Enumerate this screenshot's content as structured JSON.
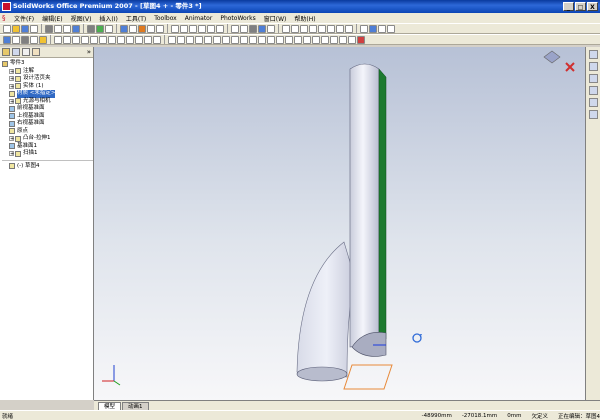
{
  "window": {
    "title": "SolidWorks Office Premium 2007 - [草图4 + - 零件3 *]",
    "buttons": [
      "_",
      "□",
      "X"
    ]
  },
  "menu": {
    "items": [
      "文件(F)",
      "编辑(E)",
      "视图(V)",
      "插入(I)",
      "工具(T)",
      "Toolbox",
      "Animator",
      "PhotoWorks",
      "窗口(W)",
      "帮助(H)"
    ]
  },
  "feature_tree": {
    "items": [
      {
        "label": "零件3",
        "level": 0,
        "icon": "part-icon"
      },
      {
        "label": "注解",
        "level": 1,
        "icon": "annotation-icon",
        "expander": "+"
      },
      {
        "label": "设计活页夹",
        "level": 1,
        "icon": "design-binder-icon",
        "expander": "+"
      },
      {
        "label": "实体 (1)",
        "level": 1,
        "icon": "solid-body-icon",
        "expander": "+"
      },
      {
        "label": "材质 <未指定>",
        "level": 1,
        "icon": "material-icon",
        "selected": true
      },
      {
        "label": "光源与相机",
        "level": 1,
        "icon": "lights-cameras-icon",
        "expander": "+"
      },
      {
        "label": "前视基准面",
        "level": 1,
        "icon": "plane-icon"
      },
      {
        "label": "上视基准面",
        "level": 1,
        "icon": "plane-icon"
      },
      {
        "label": "右视基准面",
        "level": 1,
        "icon": "plane-icon"
      },
      {
        "label": "原点",
        "level": 1,
        "icon": "origin-icon"
      },
      {
        "label": "凸台-拉伸1",
        "level": 1,
        "icon": "extrude-icon",
        "expander": "+"
      },
      {
        "label": "基准面1",
        "level": 1,
        "icon": "plane-icon"
      },
      {
        "label": "扫描1",
        "level": 1,
        "icon": "sweep-icon",
        "expander": "+"
      },
      {
        "label": "(-) 草图4",
        "level": 1,
        "icon": "sketch-icon"
      }
    ]
  },
  "bottom_tabs": [
    "模型",
    "动画1"
  ],
  "bottom_model_label": "模型",
  "status": {
    "left": "就绪",
    "x": "-48990mm",
    "y": "-27018.1mm",
    "z": "0mm",
    "state": "欠定义",
    "mode": "正在编辑：草图4"
  },
  "colors": {
    "titlebar": "#0b45b5",
    "model_body": "#e9ebf5",
    "green_face": "#1d7a2f",
    "viewport_top": "#b7c1d6",
    "selection_orange": "#e88a3a"
  }
}
